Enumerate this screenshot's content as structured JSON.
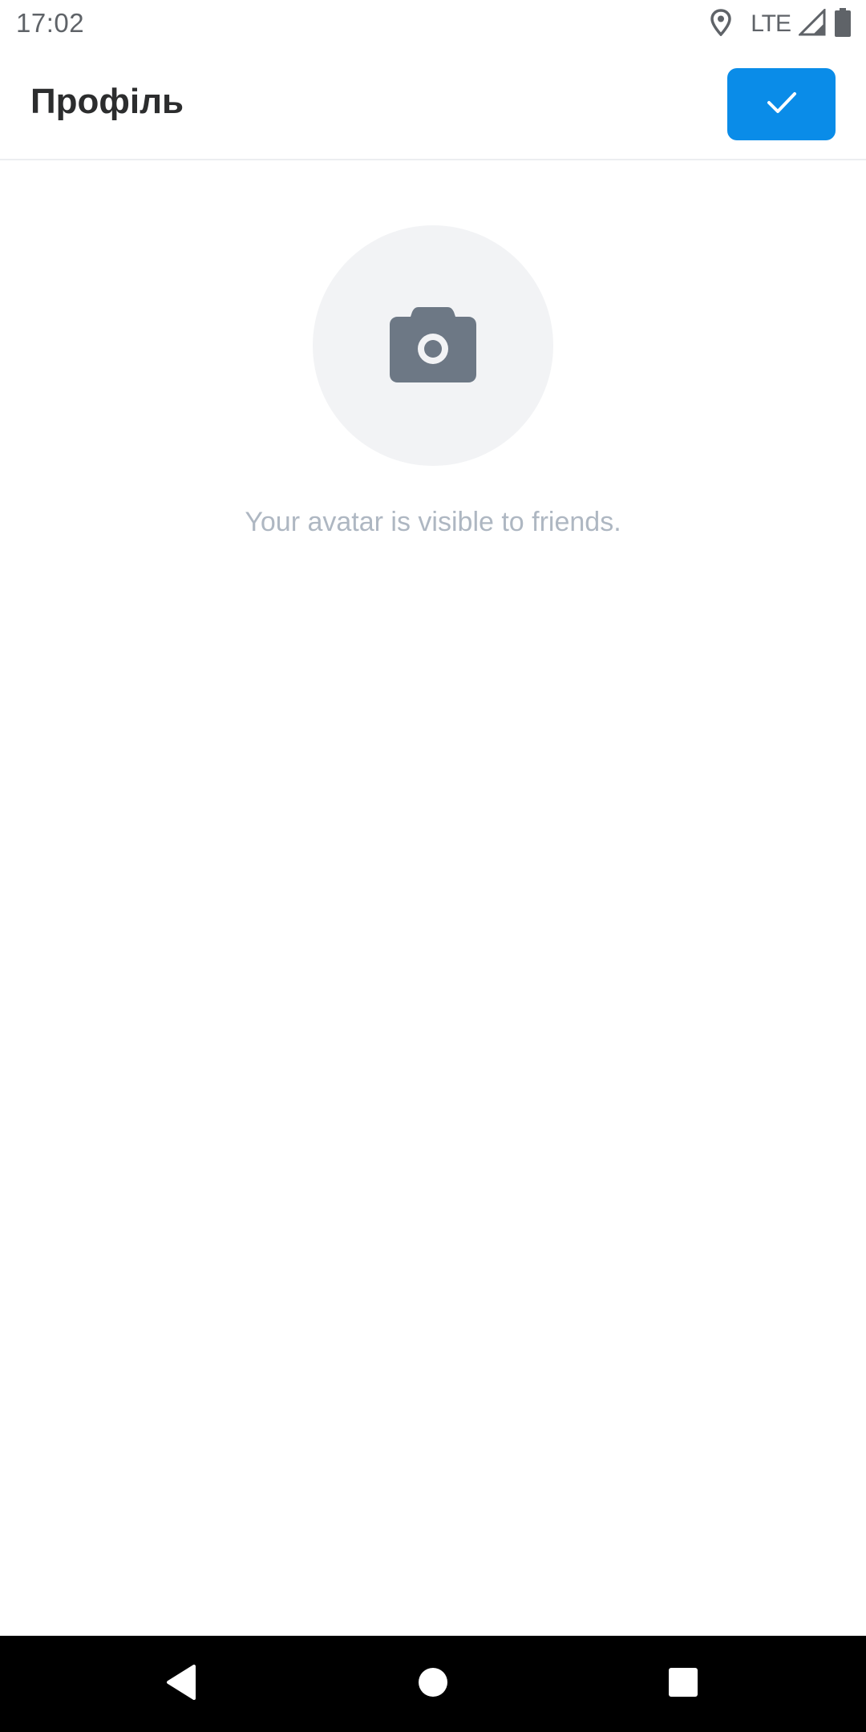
{
  "status_bar": {
    "time": "17:02",
    "network": "LTE",
    "icons": [
      "location-icon",
      "signal-icon",
      "battery-icon"
    ]
  },
  "header": {
    "title": "Профіль",
    "confirm_icon": "check-icon"
  },
  "avatar": {
    "icon": "camera-icon",
    "hint": "Your avatar is visible to friends."
  },
  "nav_bar": {
    "buttons": [
      "back-icon",
      "home-icon",
      "recents-icon"
    ]
  },
  "colors": {
    "accent": "#0a8ce8",
    "avatar_bg": "#f2f3f5",
    "camera": "#6d7885",
    "hint_text": "#aeb7c2",
    "title_text": "#2c2d2e"
  }
}
